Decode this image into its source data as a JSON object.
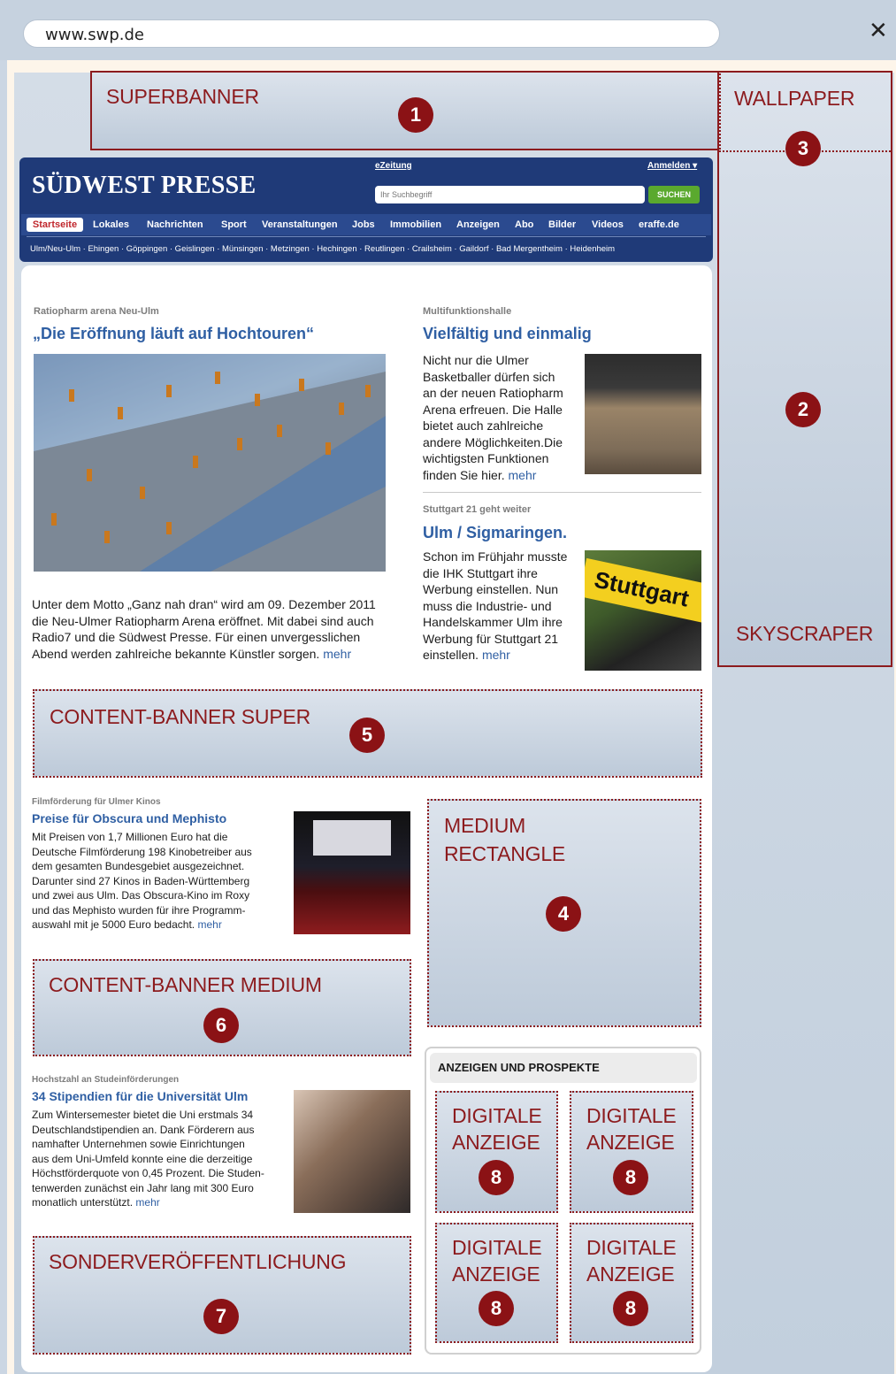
{
  "browser": {
    "url": "www.swp.de",
    "close_glyph": "✕"
  },
  "ad_zones": {
    "superbanner": {
      "label": "SUPERBANNER",
      "badge": "1"
    },
    "wallpaper": {
      "label": "WALLPAPER",
      "badge": "3"
    },
    "skyscraper": {
      "label": "SKYSCRAPER",
      "badge": "2"
    },
    "content_banner_super": {
      "label": "CONTENT-BANNER SUPER",
      "badge": "5"
    },
    "medium_rectangle": {
      "label_line1": "MEDIUM",
      "label_line2": "RECTANGLE",
      "badge": "4"
    },
    "content_banner_medium": {
      "label": "CONTENT-BANNER MEDIUM",
      "badge": "6"
    },
    "sonderveroeffentlichung": {
      "label": "SONDERVERÖFFENTLICHUNG",
      "badge": "7"
    },
    "digitale_anzeigen": [
      {
        "line1": "DIGITALE",
        "line2": "ANZEIGE",
        "badge": "8"
      },
      {
        "line1": "DIGITALE",
        "line2": "ANZEIGE",
        "badge": "8"
      },
      {
        "line1": "DIGITALE",
        "line2": "ANZEIGE",
        "badge": "8"
      },
      {
        "line1": "DIGITALE",
        "line2": "ANZEIGE",
        "badge": "8"
      }
    ]
  },
  "header": {
    "logo": "SÜDWEST PRESSE",
    "ezeitung": "eZeitung",
    "anmelden": "Anmelden ▾",
    "search_placeholder": "Ihr Suchbegriff",
    "search_button": "SUCHEN",
    "nav": [
      "Startseite",
      "Lokales",
      "Nachrichten",
      "Sport",
      "Veranstaltungen",
      "Jobs",
      "Immobilien",
      "Anzeigen",
      "Abo",
      "Bilder",
      "Videos",
      "eraffe.de"
    ],
    "sublinks": "Ulm/Neu-Ulm · Ehingen · Göppingen · Geislingen · Münsingen · Metzingen · Hechingen · Reutlingen · Crailsheim · Gaildorf · Bad Mergentheim · Heidenheim"
  },
  "articles": {
    "main": {
      "kicker": "Ratiopharm arena Neu-Ulm",
      "headline": "„Die Eröffnung läuft auf Hochtouren“",
      "lines": [
        "Unter dem Motto „Ganz nah dran“ wird am 09. Dezember 2011",
        "die Neu-Ulmer Ratiopharm Arena eröffnet. Mit dabei sind auch",
        "Radio7 und die Südwest Presse. Für einen unvergesslichen",
        "Abend werden zahlreiche bekannte Künstler sorgen."
      ],
      "more": "mehr"
    },
    "side1": {
      "kicker": "Multifunktionshalle",
      "headline": "Vielfältig und einmalig",
      "lines": [
        "Nicht nur die Ulmer",
        "Basketballer dürfen sich",
        "an der neuen Ratiopharm",
        "Arena erfreuen. Die Halle",
        "bietet auch zahlreiche",
        "andere Möglichkeiten.Die",
        "wichtigsten Funktionen",
        "finden Sie hier."
      ],
      "more": "mehr"
    },
    "side2": {
      "kicker": "Stuttgart 21 geht weiter",
      "headline": "Ulm / Sigmaringen.",
      "lines": [
        "Schon im Frühjahr musste",
        "die IHK Stuttgart ihre",
        "Werbung einstellen. Nun",
        "muss die Industrie- und",
        "Handelskammer Ulm ihre",
        "Werbung für Stuttgart 21",
        "einstellen."
      ],
      "more": "mehr",
      "image_text": "Stuttgart"
    },
    "kino": {
      "kicker": "Filmförderung für Ulmer Kinos",
      "headline": "Preise für Obscura und Mephisto",
      "lines": [
        "Mit Preisen von 1,7 Millionen Euro hat die",
        "Deutsche Filmförderung 198 Kinobetreiber aus",
        "dem gesamten Bundesgebiet ausgezeichnet.",
        "Darunter sind 27 Kinos in Baden-Württemberg",
        "und zwei aus Ulm. Das Obscura-Kino im Roxy",
        "und das Mephisto wurden für ihre Programm-",
        "auswahl mit je 5000 Euro bedacht."
      ],
      "more": "mehr"
    },
    "uni": {
      "kicker": "Hochstzahl an Studeinförderungen",
      "headline": "34 Stipendien für die Universität Ulm",
      "lines": [
        "Zum Wintersemester bietet die Uni erstmals 34",
        "Deutschlandstipendien an. Dank Förderern aus",
        "namhafter Unternehmen sowie Einrichtungen",
        "aus dem Uni-Umfeld konnte eine die derzeitige",
        "Höchstförderquote von 0,45 Prozent. Die Studen-",
        "tenwerden zunächst ein Jahr lang mit 300 Euro",
        "monatlich unterstützt."
      ],
      "more": "mehr"
    }
  },
  "anzeigen": {
    "title": "ANZEIGEN UND PROSPEKTE"
  },
  "colors": {
    "accent": "#8c1b1e",
    "header_blue": "#1f3a78",
    "link_blue": "#2f5fa3",
    "search_green": "#5aa92e"
  }
}
